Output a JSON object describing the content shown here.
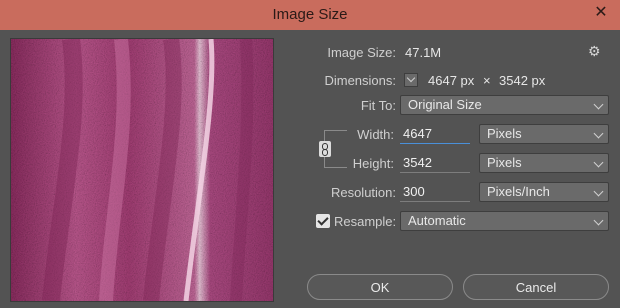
{
  "window": {
    "title": "Image Size",
    "close_glyph": "✕"
  },
  "info": {
    "image_size_label": "Image Size:",
    "image_size_value": "47.1M",
    "dimensions_label": "Dimensions:",
    "dimensions_w": "4647 px",
    "dimensions_x": "×",
    "dimensions_h": "3542 px"
  },
  "fit_to": {
    "label": "Fit To:",
    "value": "Original Size"
  },
  "width": {
    "label": "Width:",
    "value": "4647",
    "unit": "Pixels"
  },
  "height": {
    "label": "Height:",
    "value": "3542",
    "unit": "Pixels"
  },
  "resolution": {
    "label": "Resolution:",
    "value": "300",
    "unit": "Pixels/Inch"
  },
  "resample": {
    "label": "Resample:",
    "checked": true,
    "value": "Automatic"
  },
  "buttons": {
    "ok": "OK",
    "cancel": "Cancel"
  },
  "icons": {
    "gear": "gear-icon",
    "link": "link-chain-icon",
    "close": "close-icon"
  },
  "colors": {
    "titlebar": "#c96c5d",
    "dialog_bg": "#535353",
    "fabric": "#b04c84"
  }
}
